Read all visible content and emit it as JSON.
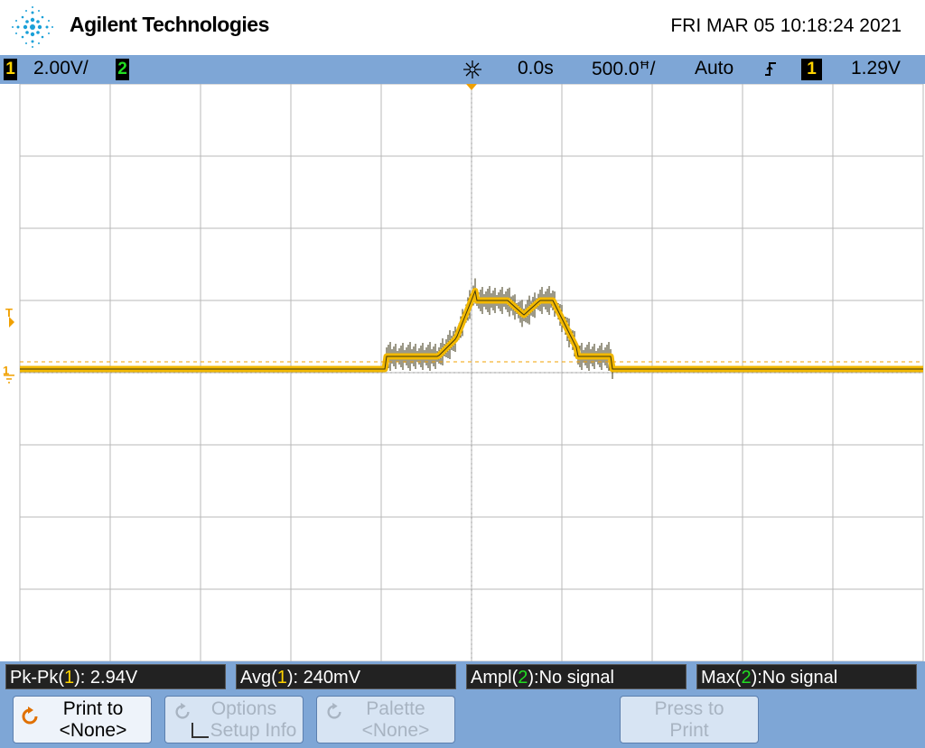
{
  "header": {
    "brand": "Agilent Technologies",
    "datetime": "FRI MAR 05 10:18:24 2021"
  },
  "status": {
    "ch1_num": "1",
    "ch1_scale": "2.00V/",
    "ch2_num": "2",
    "trigger_pos_icon": "trigger-position-icon",
    "time_offset": "0.0s",
    "time_scale": "500.0ꟸ/",
    "trigger_mode": "Auto",
    "trigger_edge_icon": "rising-edge-icon",
    "trigger_source": "1",
    "trigger_level": "1.29V"
  },
  "markers": {
    "trigger_marker": "T",
    "ch1_ground": "1"
  },
  "measurements": {
    "m1_prefix": "Pk-Pk(",
    "m1_ch": "1",
    "m1_suffix": "): 2.94V",
    "m2_prefix": "Avg(",
    "m2_ch": "1",
    "m2_suffix": "): 240mV",
    "m3_prefix": "Ampl(",
    "m3_ch": "2",
    "m3_suffix": "):No signal",
    "m4_prefix": "Max(",
    "m4_ch": "2",
    "m4_suffix": "):No signal"
  },
  "softkeys": {
    "print_to_line1": "Print to",
    "print_to_line2": "<None>",
    "options_line1": "Options",
    "options_line2": "Setup Info",
    "palette_line1": "Palette",
    "palette_line2": "<None>",
    "press_line1": "Press to",
    "press_line2": "Print"
  },
  "colors": {
    "ch1": "#ffd400",
    "ch2": "#22dd22",
    "bar": "#7ea6d6",
    "trace": "#f2b800"
  }
}
